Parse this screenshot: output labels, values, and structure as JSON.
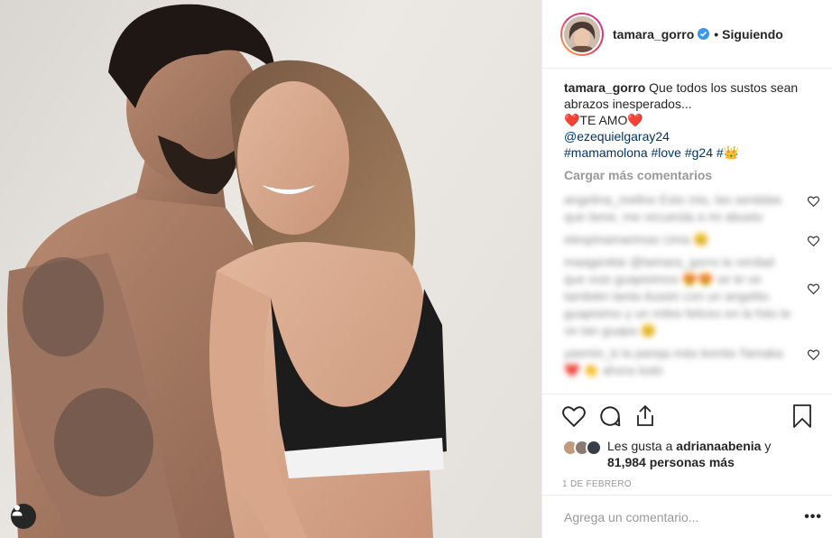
{
  "post": {
    "user_tag_icon": "person-icon"
  },
  "header": {
    "username": "tamara_gorro",
    "verified_icon": "verified-badge-icon",
    "separator": "•",
    "follow_status": "Siguiendo"
  },
  "caption": {
    "username": "tamara_gorro",
    "text": "Que todos los sustos sean abrazos inesperados...",
    "line2": "❤️TE AMO❤️",
    "mention": "@ezequielgaray24",
    "hashtags": "#mamamolona #love #g24 #👑"
  },
  "load_more": "Cargar más comentarios",
  "blurred_comments": [
    {
      "text": "angelina_mellno Esto mis, las sentidas que tiene, me recuerda a mi abuelo"
    },
    {
      "text": "elespinamarimas Uma 😊"
    },
    {
      "text": "maagenkte @tamara_gorro la verdad que sois guapisimos 😍😍 se te ve también tanta ilusión con un angelito guapisimo y un miles felices en la foto te ve tan guapa 😊"
    },
    {
      "text": "yasmin_b la pareja más bonita Tamaka ❤️ 👏 ahora todo"
    }
  ],
  "actions": {
    "like_icon": "heart-icon",
    "comment_icon": "comment-icon",
    "share_icon": "share-icon",
    "save_icon": "bookmark-icon"
  },
  "likes": {
    "prefix": "Les gusta a ",
    "user": "adrianaabenia",
    "middle": " y",
    "count": "81,984 personas más"
  },
  "date": "1 DE FEBRERO",
  "add_comment": {
    "placeholder": "Agrega un comentario...",
    "options": "•••"
  },
  "colors": {
    "link": "#003569",
    "muted": "#999999",
    "verified": "#3897f0",
    "border": "#efefef"
  }
}
